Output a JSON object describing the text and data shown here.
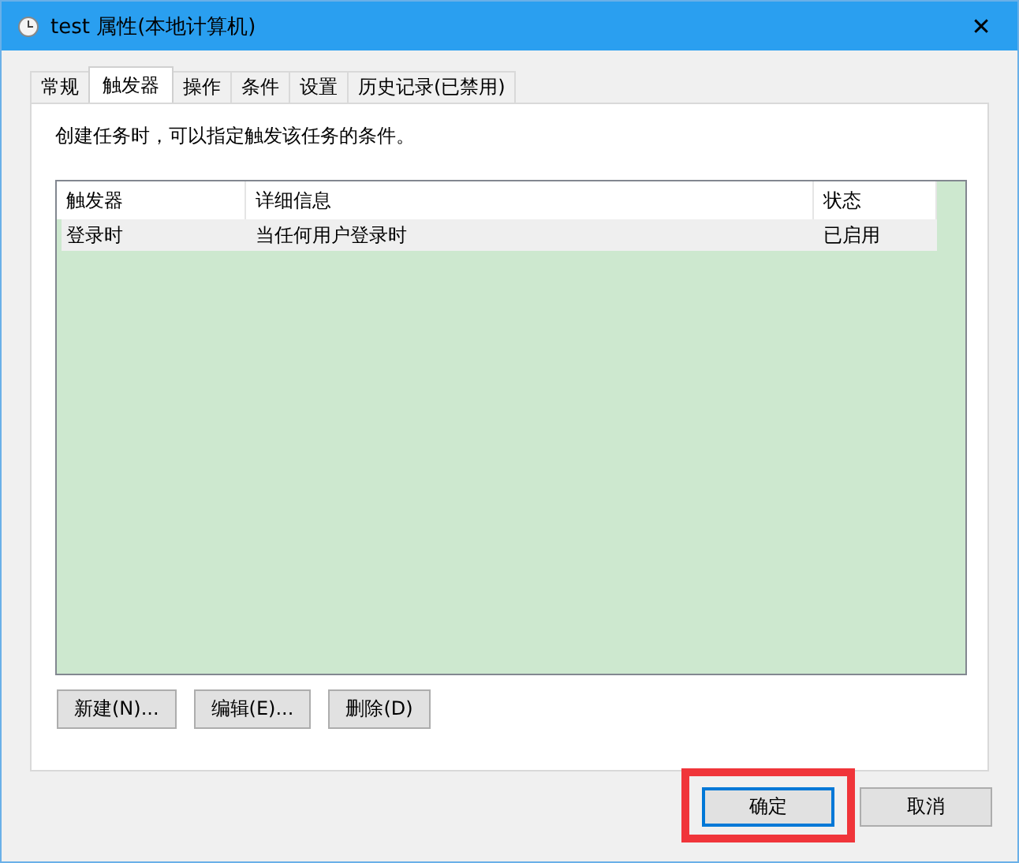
{
  "window": {
    "title": "test 属性(本地计算机)",
    "close": "✕"
  },
  "tabs": [
    {
      "label": "常规",
      "selected": false
    },
    {
      "label": "触发器",
      "selected": true
    },
    {
      "label": "操作",
      "selected": false
    },
    {
      "label": "条件",
      "selected": false
    },
    {
      "label": "设置",
      "selected": false
    },
    {
      "label": "历史记录(已禁用)",
      "selected": false
    }
  ],
  "description": "创建任务时，可以指定触发该任务的条件。",
  "table": {
    "columns": [
      "触发器",
      "详细信息",
      "状态"
    ],
    "rows": [
      {
        "cells": [
          "登录时",
          "当任何用户登录时",
          "已启用"
        ],
        "selected": true
      }
    ]
  },
  "trigger_buttons": [
    "新建(N)...",
    "编辑(E)...",
    "删除(D)"
  ],
  "dialog_buttons": [
    {
      "label": "确定",
      "default": true,
      "highlighted": true
    },
    {
      "label": "取消",
      "default": false,
      "highlighted": false
    }
  ]
}
